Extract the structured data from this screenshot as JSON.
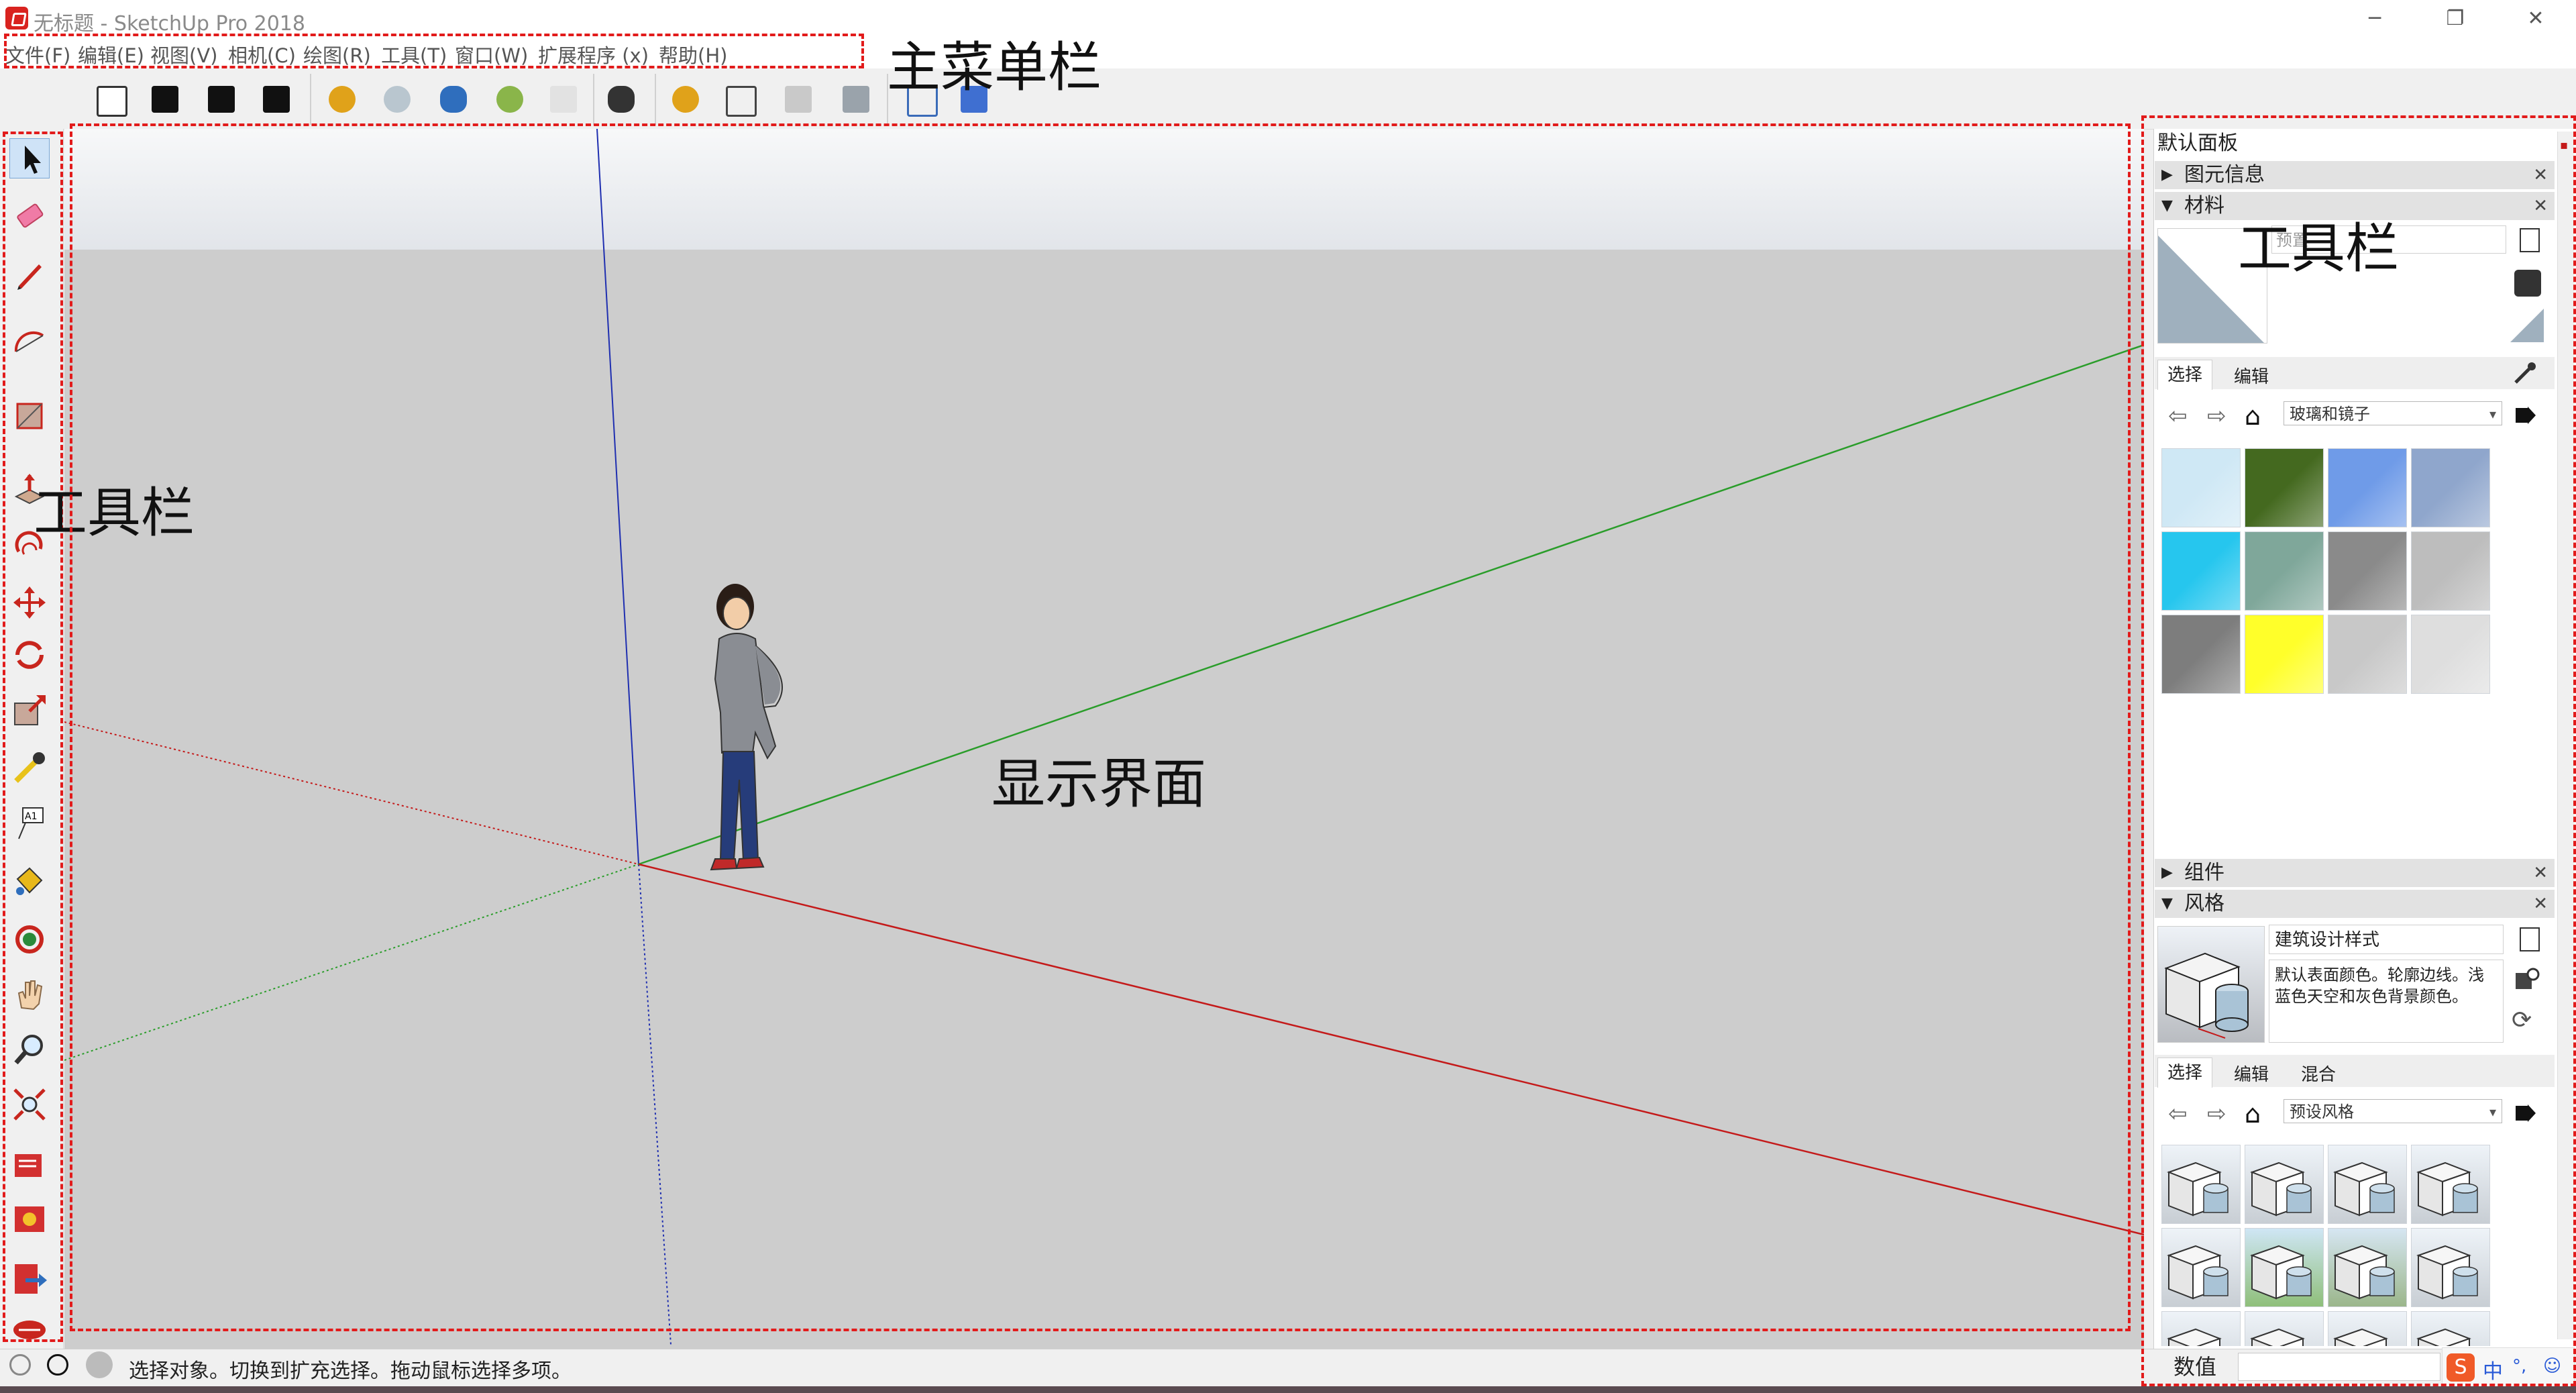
{
  "window": {
    "title": "无标题 - SketchUp Pro 2018",
    "controls": {
      "minimize": "─",
      "restore": "❐",
      "close": "✕"
    }
  },
  "menu": [
    "文件(F)",
    "编辑(E)",
    "视图(V)",
    "相机(C)",
    "绘图(R)",
    "工具(T)",
    "窗口(W)",
    "扩展程序 (x)",
    "帮助(H)"
  ],
  "annotations": {
    "menubar": "主菜单栏",
    "left_toolbar": "工具栏",
    "viewport": "显示界面",
    "right_tray": "工具栏"
  },
  "tray": {
    "title": "默认面板",
    "entity_info": "图元信息",
    "materials": {
      "title": "材料",
      "name_placeholder": "预置",
      "tabs": [
        "选择",
        "编辑"
      ],
      "collection": "玻璃和镜子",
      "swatch_colors": [
        "#cfe8f5",
        "#44691f",
        "#6f9be8",
        "#8fa6cc",
        "#26c6ee",
        "#7fa79a",
        "#8a8a8a",
        "#bdbdbd",
        "#7d7d7d",
        "#ffff2a",
        "#c8c8c8",
        "#dedede"
      ]
    },
    "components": "组件",
    "styles": {
      "title": "风格",
      "style_name": "建筑设计样式",
      "style_desc": "默认表面颜色。轮廓边线。浅蓝色天空和灰色背景颜色。",
      "tabs": [
        "选择",
        "编辑",
        "混合"
      ],
      "collection": "预设风格"
    }
  },
  "status": {
    "text": "选择对象。切换到扩充选择。拖动鼠标选择多项。",
    "measure_label": "数值",
    "ime": "中"
  },
  "colors": {
    "axis_red": "#c41a1a",
    "axis_green": "#2a9d2a",
    "axis_blue": "#1f2fb0",
    "annotation": "#e21b1b"
  }
}
